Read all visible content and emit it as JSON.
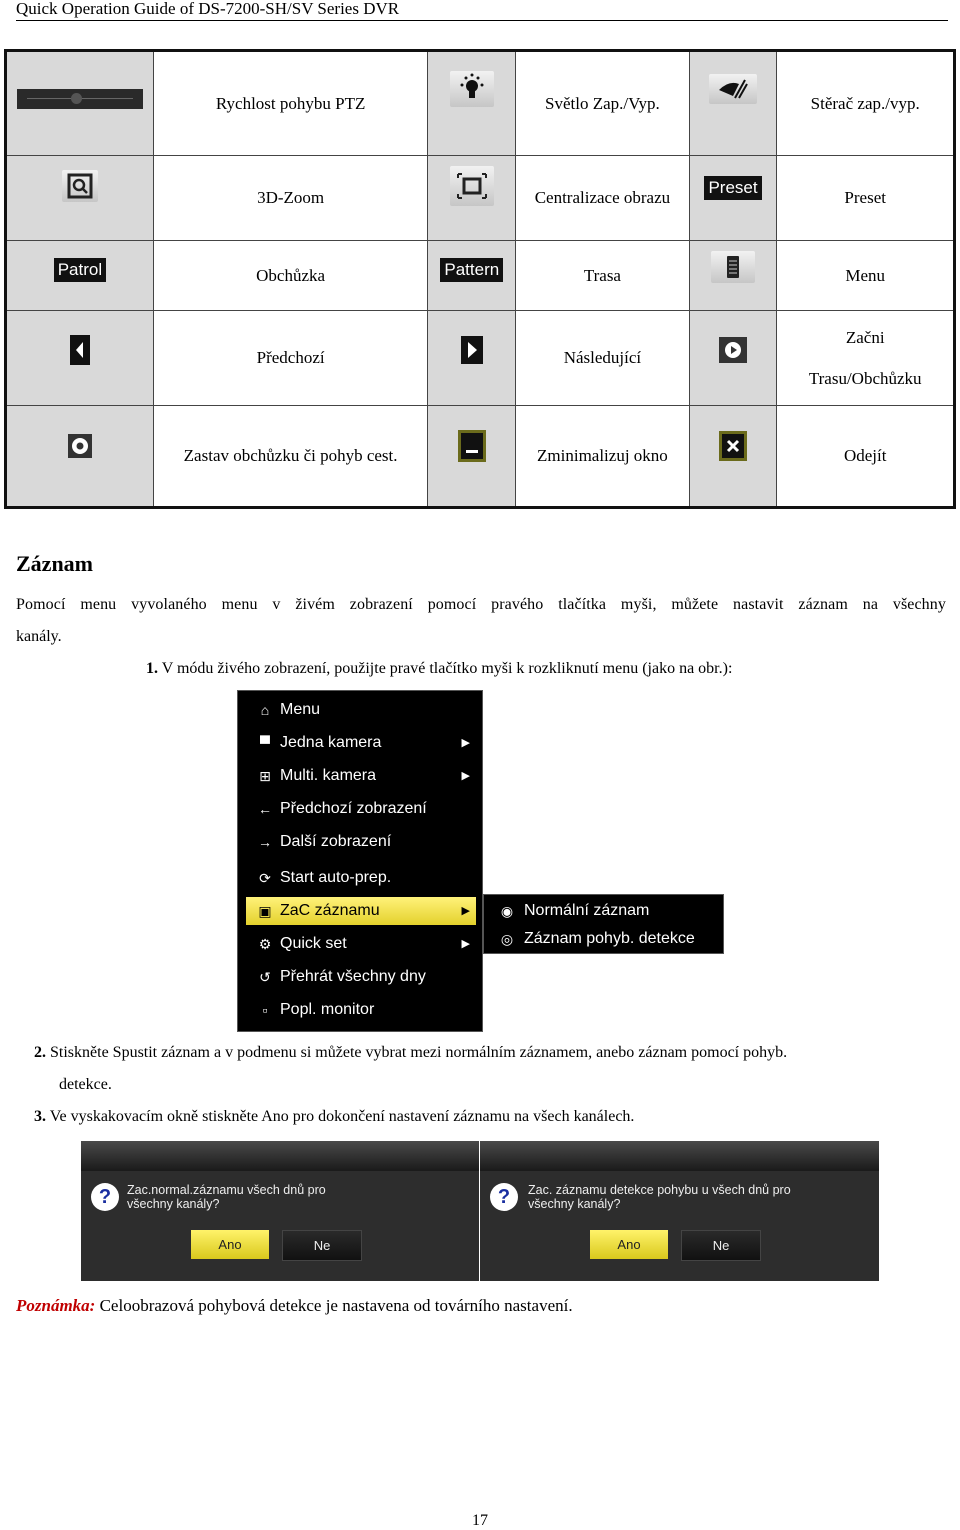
{
  "header": {
    "title": "Quick Operation Guide of DS-7200-SH/SV Series DVR"
  },
  "ptz_table": {
    "rows": [
      [
        {
          "icon": "ptz-speed-slider-icon",
          "label": "Rychlost pohybu PTZ"
        },
        {
          "icon": "light-bulb-icon",
          "label": "Světlo Zap./Vyp."
        },
        {
          "icon": "wiper-icon",
          "label": "Stěrač zap./vyp."
        }
      ],
      [
        {
          "icon": "3d-zoom-icon",
          "label": "3D-Zoom"
        },
        {
          "icon": "center-image-icon",
          "label": "Centralizace obrazu"
        },
        {
          "icon": "preset-button",
          "icon_text": "Preset",
          "label": "Preset"
        }
      ],
      [
        {
          "icon": "patrol-button",
          "icon_text": "Patrol",
          "label": "Obchůzka"
        },
        {
          "icon": "pattern-button",
          "icon_text": "Pattern",
          "label": "Trasa"
        },
        {
          "icon": "menu-list-icon",
          "label": "Menu"
        }
      ],
      [
        {
          "icon": "previous-icon",
          "label": "Předchozí"
        },
        {
          "icon": "next-icon",
          "label": "Následující"
        },
        {
          "icon": "start-pattern-icon",
          "label_line1": "Začni",
          "label_line2": "Trasu/Obchůzku"
        }
      ],
      [
        {
          "icon": "stop-patrol-icon",
          "label": "Zastav obchůzku či pohyb cest."
        },
        {
          "icon": "minimize-icon",
          "label": "Zminimalizuj okno"
        },
        {
          "icon": "close-icon",
          "label": "Odejít"
        }
      ]
    ]
  },
  "section": {
    "title": "Záznam",
    "intro": "Pomocí menu vyvolaného menu v živém zobrazení pomocí pravého tlačítka myši, můžete nastavit záznam na všechny kanály.",
    "intro_line1": "Pomocí menu vyvolaného menu v živém zobrazení pomocí pravého tlačítka myši, můžete nastavit záznam na všechny",
    "intro_line2": "kanály.",
    "steps": [
      {
        "num": "1.",
        "text": "V módu živého zobrazení, použijte pravé tlačítko myši k rozkliknutí menu (jako na obr.):"
      },
      {
        "num": "2.",
        "text_line1": "Stiskněte Spustit záznam a v podmenu si můžete vybrat mezi normálním záznamem, anebo záznam pomocí pohyb.",
        "text_line2": "detekce."
      },
      {
        "num": "3.",
        "text": "Ve vyskakovacím okně stiskněte Ano pro dokončení nastavení záznamu na všech kanálech."
      }
    ]
  },
  "context_menu": {
    "items": [
      {
        "icon": "home-icon",
        "glyph": "⌂",
        "label": "Menu",
        "submenu": false
      },
      {
        "icon": "camera-icon",
        "glyph": "▀",
        "label": "Jedna kamera",
        "submenu": true
      },
      {
        "icon": "multi-camera-icon",
        "glyph": "⊞",
        "label": "Multi. kamera",
        "submenu": true
      },
      {
        "icon": "arrow-left-icon",
        "glyph": "←",
        "label": "Předchozí zobrazení",
        "submenu": false
      },
      {
        "icon": "arrow-right-icon",
        "glyph": "→",
        "label": "Další zobrazení",
        "submenu": false
      },
      {
        "icon": "refresh-icon",
        "glyph": "⟳",
        "label": "Start auto-prep.",
        "submenu": false
      },
      {
        "icon": "record-icon",
        "glyph": "▣",
        "label": "ZaC záznamu",
        "submenu": true,
        "selected": true
      },
      {
        "icon": "gear-icon",
        "glyph": "⚙",
        "label": "Quick set",
        "submenu": true
      },
      {
        "icon": "playback-icon",
        "glyph": "↺",
        "label": "Přehrát všechny dny",
        "submenu": false
      },
      {
        "icon": "aux-monitor-icon",
        "glyph": "▫",
        "label": "Popl. monitor",
        "submenu": false
      }
    ],
    "arrow_glyph": "▶",
    "submenu": [
      {
        "icon": "normal-record-icon",
        "glyph": "◉",
        "label": "Normální záznam"
      },
      {
        "icon": "motion-record-icon",
        "glyph": "◎",
        "label": "Záznam pohyb. detekce"
      }
    ]
  },
  "dialogs": [
    {
      "message_line1": "Zac.normal.záznamu všech dnů pro",
      "message_line2": "všechny kanály?",
      "yes": "Ano",
      "no": "Ne"
    },
    {
      "message_line1": "Zac. záznamu detekce pohybu u všech dnů pro",
      "message_line2": "všechny kanály?",
      "yes": "Ano",
      "no": "Ne"
    }
  ],
  "note": {
    "label": "Poznámka:",
    "text": "Celoobrazová pohybová detekce je nastavena od továrního nastavení."
  },
  "page_number": "17",
  "colors": {
    "note_label": "#c00000",
    "selected_item": "#f0e040"
  }
}
